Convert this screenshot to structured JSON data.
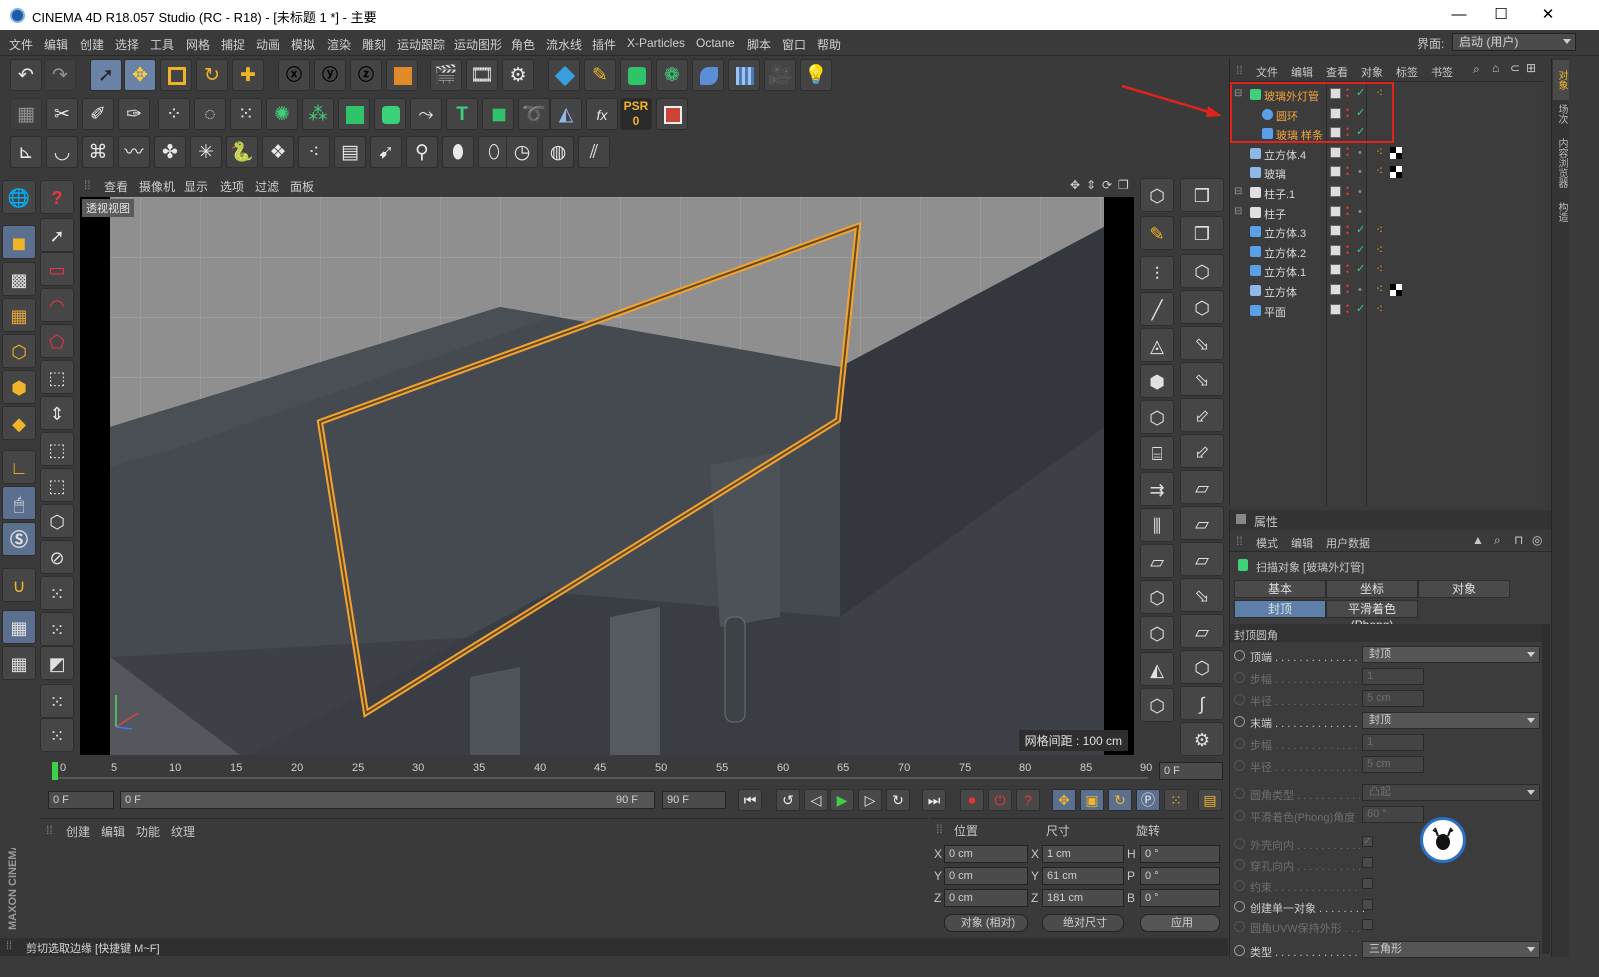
{
  "titlebar": {
    "title": "CINEMA 4D R18.057 Studio (RC - R18) - [未标题 1 *] - 主要",
    "minimize": "—",
    "maximize": "☐",
    "close": "✕"
  },
  "menu": [
    "文件",
    "编辑",
    "创建",
    "选择",
    "工具",
    "网格",
    "捕捉",
    "动画",
    "模拟",
    "渲染",
    "雕刻",
    "运动跟踪",
    "运动图形",
    "角色",
    "流水线",
    "插件",
    "X-Particles",
    "Octane",
    "脚本",
    "窗口",
    "帮助"
  ],
  "layout": {
    "label": "界面:",
    "value": "启动 (用户)"
  },
  "viewport": {
    "menu": [
      "查看",
      "摄像机",
      "显示",
      "选项",
      "过滤",
      "面板"
    ],
    "label": "透视视图",
    "grid_spacing": "网格间距 : 100 cm"
  },
  "timeline": {
    "ticks": [
      "0",
      "5",
      "10",
      "15",
      "20",
      "25",
      "30",
      "35",
      "40",
      "45",
      "50",
      "55",
      "60",
      "65",
      "70",
      "75",
      "80",
      "85",
      "90"
    ],
    "current_frame": "0 F",
    "start_frame": "0 F",
    "range_start": "0 F",
    "range_end": "90 F",
    "end_frame": "90 F",
    "end_field": "0 F"
  },
  "material_manager": {
    "menu": [
      "创建",
      "编辑",
      "功能",
      "纹理"
    ]
  },
  "coordinates": {
    "headers": [
      "位置",
      "尺寸",
      "旋转"
    ],
    "rows": [
      {
        "axis": "X",
        "pos": "0 cm",
        "size_axis": "X",
        "size": "1 cm",
        "rot_axis": "H",
        "rot": "0 °"
      },
      {
        "axis": "Y",
        "pos": "0 cm",
        "size_axis": "Y",
        "size": "61 cm",
        "rot_axis": "P",
        "rot": "0 °"
      },
      {
        "axis": "Z",
        "pos": "0 cm",
        "size_axis": "Z",
        "size": "181 cm",
        "rot_axis": "B",
        "rot": "0 °"
      }
    ],
    "mode": "对象 (相对)",
    "size_mode": "绝对尺寸",
    "apply": "应用"
  },
  "status": "剪切选取边缘 [快捷键 M~F]",
  "object_manager": {
    "menu": [
      "文件",
      "编辑",
      "查看",
      "对象",
      "标签",
      "书签"
    ],
    "objects": [
      {
        "name": "玻璃外灯管",
        "color": "#f2a33a",
        "icon": "sweep-icon"
      },
      {
        "name": "圆环",
        "color": "#f2a33a",
        "icon": "circle-spline-icon"
      },
      {
        "name": "玻璃 样条",
        "color": "#f2a33a",
        "icon": "spline-icon"
      },
      {
        "name": "立方体.4",
        "color": "#d8d8d8",
        "icon": "polygon-object-icon"
      },
      {
        "name": "玻璃",
        "color": "#d8d8d8",
        "icon": "polygon-object-icon"
      },
      {
        "name": "柱子.1",
        "color": "#d8d8d8",
        "icon": "null-object-icon"
      },
      {
        "name": "柱子",
        "color": "#d8d8d8",
        "icon": "null-object-icon"
      },
      {
        "name": "立方体.3",
        "color": "#d8d8d8",
        "icon": "cube-icon"
      },
      {
        "name": "立方体.2",
        "color": "#d8d8d8",
        "icon": "cube-icon"
      },
      {
        "name": "立方体.1",
        "color": "#d8d8d8",
        "icon": "cube-icon"
      },
      {
        "name": "立方体",
        "color": "#d8d8d8",
        "icon": "polygon-object-icon"
      },
      {
        "name": "平面",
        "color": "#d8d8d8",
        "icon": "plane-icon"
      }
    ]
  },
  "attributes": {
    "title": "属性",
    "menu": [
      "模式",
      "编辑",
      "用户数据"
    ],
    "object_label": "扫描对象 [玻璃外灯管]",
    "tabs": [
      "基本",
      "坐标",
      "对象",
      "封顶",
      "平滑着色(Phong)"
    ],
    "section": "封顶圆角",
    "rows": [
      {
        "label": "顶端 . . . . . . . . . . . . . .",
        "value": "封顶",
        "dim": false,
        "type": "select"
      },
      {
        "label": "步幅 . . . . . . . . . . . . . .",
        "value": "1",
        "dim": true,
        "type": "num"
      },
      {
        "label": "半径 . . . . . . . . . . . . . .",
        "value": "5 cm",
        "dim": true,
        "type": "num"
      },
      {
        "label": "末端 . . . . . . . . . . . . . .",
        "value": "封顶",
        "dim": false,
        "type": "select"
      },
      {
        "label": "步幅 . . . . . . . . . . . . . .",
        "value": "1",
        "dim": true,
        "type": "num"
      },
      {
        "label": "半径 . . . . . . . . . . . . . .",
        "value": "5 cm",
        "dim": true,
        "type": "num"
      },
      {
        "label": "圆角类型 . . . . . . . . . . .",
        "value": "凸起",
        "dim": true,
        "type": "select"
      },
      {
        "label": "平滑着色(Phong)角度",
        "value": "60 °",
        "dim": true,
        "type": "num"
      },
      {
        "label": "外壳向内 . . . . . . . . . . .",
        "value": "✓",
        "dim": true,
        "type": "check"
      },
      {
        "label": "穿孔向内 . . . . . . . . . . .",
        "value": "",
        "dim": true,
        "type": "check"
      },
      {
        "label": "约束 . . . . . . . . . . . . . .",
        "value": "",
        "dim": true,
        "type": "check"
      },
      {
        "label": "创建单一对象 . . . . . . . .",
        "value": "",
        "dim": false,
        "type": "check"
      },
      {
        "label": "圆角UVW保持外形 . . .",
        "value": "",
        "dim": true,
        "type": "check"
      },
      {
        "label": "类型 . . . . . . . . . . . . . .",
        "value": "三角形",
        "dim": false,
        "type": "select"
      }
    ]
  },
  "side_tabs": [
    "对象",
    "场次",
    "内容浏览器",
    "构造"
  ],
  "brand": "MAXON CINEMA 4D",
  "colors": {
    "accent": "#5d7fa8",
    "selection": "#f2a33a",
    "highlight_box": "#e0231c"
  }
}
